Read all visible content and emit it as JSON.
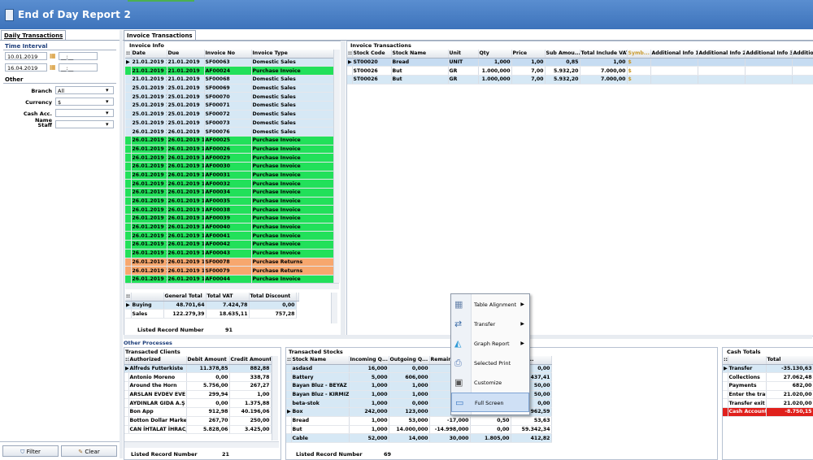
{
  "window": {
    "title": "End of Day Report 2"
  },
  "left_panel": {
    "tab_label": "Daily Transactions",
    "time_interval_label": "Time Interval",
    "date_from": "10.01.2019",
    "date_to": "16.04.2019",
    "time_from": "__:__",
    "time_to": "__:__",
    "other_label": "Other",
    "fields": [
      {
        "label": "Branch",
        "value": "All"
      },
      {
        "label": "Currency",
        "value": "$"
      },
      {
        "label": "Cash Acc. Name",
        "value": ""
      },
      {
        "label": "Staff",
        "value": ""
      }
    ],
    "filter_label": "Filter",
    "clear_label": "Clear"
  },
  "main_tab": "Invoice Transactions",
  "invoice_info": {
    "title": "Invoice Info",
    "columns": [
      "Date",
      "Due",
      "Invoice No",
      "Invoice Type"
    ],
    "rows": [
      {
        "date": "21.01.2019 1",
        "due": "21.01.2019",
        "no": "SF00063",
        "type": "Domestic Sales",
        "color": "#d6e8f5"
      },
      {
        "date": "21.01.2019 1",
        "due": "21.01.2019",
        "no": "AF00024",
        "type": "Purchase Invoice",
        "color": "#22e05a"
      },
      {
        "date": "21.01.2019 1",
        "due": "21.01.2019",
        "no": "SF00068",
        "type": "Domestic Sales",
        "color": "#d6e8f5"
      },
      {
        "date": "25.01.2019 1",
        "due": "25.01.2019",
        "no": "SF00069",
        "type": "Domestic Sales",
        "color": "#d6e8f5"
      },
      {
        "date": "25.01.2019 1",
        "due": "25.01.2019",
        "no": "SF00070",
        "type": "Domestic Sales",
        "color": "#d6e8f5"
      },
      {
        "date": "25.01.2019 1",
        "due": "25.01.2019",
        "no": "SF00071",
        "type": "Domestic Sales",
        "color": "#d6e8f5"
      },
      {
        "date": "25.01.2019 1",
        "due": "25.01.2019",
        "no": "SF00072",
        "type": "Domestic Sales",
        "color": "#d6e8f5"
      },
      {
        "date": "25.01.2019 1",
        "due": "25.01.2019",
        "no": "SF00073",
        "type": "Domestic Sales",
        "color": "#d6e8f5"
      },
      {
        "date": "26.01.2019 1",
        "due": "26.01.2019",
        "no": "SF00076",
        "type": "Domestic Sales",
        "color": "#d6e8f5"
      },
      {
        "date": "26.01.2019 1",
        "due": "26.01.2019 1",
        "no": "AF00025",
        "type": "Purchase Invoice",
        "color": "#22e05a"
      },
      {
        "date": "26.01.2019 1",
        "due": "26.01.2019 1",
        "no": "AF00026",
        "type": "Purchase Invoice",
        "color": "#22e05a"
      },
      {
        "date": "26.01.2019 1",
        "due": "26.01.2019 1",
        "no": "AF00029",
        "type": "Purchase Invoice",
        "color": "#22e05a"
      },
      {
        "date": "26.01.2019 1",
        "due": "26.01.2019 1",
        "no": "AF00030",
        "type": "Purchase Invoice",
        "color": "#22e05a"
      },
      {
        "date": "26.01.2019 1",
        "due": "26.01.2019 1",
        "no": "AF00031",
        "type": "Purchase Invoice",
        "color": "#22e05a"
      },
      {
        "date": "26.01.2019 1",
        "due": "26.01.2019 1",
        "no": "AF00032",
        "type": "Purchase Invoice",
        "color": "#22e05a"
      },
      {
        "date": "26.01.2019 1",
        "due": "26.01.2019 1",
        "no": "AF00034",
        "type": "Purchase Invoice",
        "color": "#22e05a"
      },
      {
        "date": "26.01.2019 1",
        "due": "26.01.2019 1",
        "no": "AF00035",
        "type": "Purchase Invoice",
        "color": "#22e05a"
      },
      {
        "date": "26.01.2019 1",
        "due": "26.01.2019 1",
        "no": "AF00038",
        "type": "Purchase Invoice",
        "color": "#22e05a"
      },
      {
        "date": "26.01.2019 1",
        "due": "26.01.2019 1",
        "no": "AF00039",
        "type": "Purchase Invoice",
        "color": "#22e05a"
      },
      {
        "date": "26.01.2019 1",
        "due": "26.01.2019 1",
        "no": "AF00040",
        "type": "Purchase Invoice",
        "color": "#22e05a"
      },
      {
        "date": "26.01.2019 1",
        "due": "26.01.2019 1",
        "no": "AF00041",
        "type": "Purchase Invoice",
        "color": "#22e05a"
      },
      {
        "date": "26.01.2019 1",
        "due": "26.01.2019 1",
        "no": "AF00042",
        "type": "Purchase Invoice",
        "color": "#22e05a"
      },
      {
        "date": "26.01.2019 1",
        "due": "26.01.2019 1",
        "no": "AF00043",
        "type": "Purchase Invoice",
        "color": "#22e05a"
      },
      {
        "date": "26.01.2019 1",
        "due": "26.01.2019 1",
        "no": "SF00078",
        "type": "Purchase Returns",
        "color": "#f7a76e"
      },
      {
        "date": "26.01.2019 1",
        "due": "26.01.2019 1",
        "no": "SF00079",
        "type": "Purchase Returns",
        "color": "#f7a76e"
      },
      {
        "date": "26.01.2019 1",
        "due": "26.01.2019 1",
        "no": "AF00044",
        "type": "Purchase Invoice",
        "color": "#22e05a"
      }
    ]
  },
  "totals": {
    "columns": [
      "General Total",
      "Total VAT",
      "Total Discount"
    ],
    "rows": [
      {
        "label": "Buying",
        "general": "48.701,64",
        "vat": "7.424,78",
        "discount": "0,00"
      },
      {
        "label": "Sales",
        "general": "122.279,39",
        "vat": "18.635,11",
        "discount": "757,28"
      }
    ],
    "listed_label": "Listed Record Number",
    "listed_value": "91"
  },
  "invoice_transactions": {
    "title": "Invoice Transactions",
    "columns": [
      "Stock Code",
      "Stock Name",
      "Unit",
      "Qty",
      "Price",
      "Sub Amou...",
      "Total Include VAT",
      "Symb...",
      "Additional Info 1",
      "Additional Info 2",
      "Additional Info 3",
      "Additio"
    ],
    "rows": [
      {
        "code": "ST00020",
        "name": "Bread",
        "unit": "UNIT",
        "qty": "1,000",
        "price": "1,00",
        "sub": "0,85",
        "total": "1,00",
        "sym": "$"
      },
      {
        "code": "ST00026",
        "name": "But",
        "unit": "GR",
        "qty": "1.000,000",
        "price": "7,00",
        "sub": "5.932,20",
        "total": "7.000,00",
        "sym": "$"
      },
      {
        "code": "ST00026",
        "name": "But",
        "unit": "GR",
        "qty": "1.000,000",
        "price": "7,00",
        "sub": "5.932,20",
        "total": "7.000,00",
        "sym": "$"
      }
    ]
  },
  "other_processes": {
    "title": "Other Processes"
  },
  "clients": {
    "title": "Transacted Clients",
    "columns": [
      "Authorized",
      "Debit Amount",
      "Credit Amount"
    ],
    "rows": [
      {
        "name": "Alfreds Futterkiste",
        "debit": "11.378,85",
        "credit": "882,88"
      },
      {
        "name": "Antonio Moreno",
        "debit": "0,00",
        "credit": "338,78"
      },
      {
        "name": "Around the Horn",
        "debit": "5.756,00",
        "credit": "267,27"
      },
      {
        "name": "ARSLAN EVDEV EVE T/",
        "debit": "299,94",
        "credit": "1,00"
      },
      {
        "name": "AYDINLAR GIDA A.Ş",
        "debit": "0,00",
        "credit": "1.375,88"
      },
      {
        "name": "Bon App",
        "debit": "912,98",
        "credit": "40.196,06"
      },
      {
        "name": "Botton Dollar Market",
        "debit": "267,70",
        "credit": "250,00"
      },
      {
        "name": "CAN İHTALAT İHRAC/",
        "debit": "5.828,06",
        "credit": "3.425,00"
      }
    ],
    "listed_label": "Listed Record Number",
    "listed_value": "21"
  },
  "stocks": {
    "title": "Transacted Stocks",
    "columns": [
      "Stock Name",
      "Incoming Q...",
      "Outgoing Q...",
      "Remaini...",
      "",
      "Amou..."
    ],
    "rows": [
      {
        "name": "asdasd",
        "in": "16,000",
        "out": "0,000",
        "rem": "16",
        "x": "",
        "amt": "0,00"
      },
      {
        "name": "Battery",
        "in": "5,000",
        "out": "606,000",
        "rem": "-601",
        "x": "",
        "amt": "437,41"
      },
      {
        "name": "Bayan Bluz - BEYAZ -",
        "in": "1,000",
        "out": "1,000",
        "rem": "-3",
        "x": "",
        "amt": "50,00"
      },
      {
        "name": "Bayan Bluz - KIRMIZI",
        "in": "1,000",
        "out": "1,000",
        "rem": "0",
        "x": "",
        "amt": "50,00"
      },
      {
        "name": "beta-stok",
        "in": "1,000",
        "out": "0,000",
        "rem": "1",
        "x": "",
        "amt": "0,00"
      },
      {
        "name": "Box",
        "in": "242,000",
        "out": "123,000",
        "rem": "119",
        "x": "",
        "amt": "962,59"
      },
      {
        "name": "Bread",
        "in": "1,000",
        "out": "53,000",
        "rem": "-17,000",
        "x": "0,50",
        "amt": "53,63"
      },
      {
        "name": "But",
        "in": "1,000",
        "out": "14.000,000",
        "rem": "-14.998,000",
        "x": "0,00",
        "amt": "59.342,34"
      },
      {
        "name": "Cable",
        "in": "52,000",
        "out": "14,000",
        "rem": "30,000",
        "x": "1.805,00",
        "amt": "412,82"
      }
    ],
    "listed_label": "Listed Record Number",
    "listed_value": "69"
  },
  "cash_totals": {
    "title": "Cash Totals",
    "column": "Total",
    "rows": [
      {
        "name": "Transfer",
        "value": "-35.130,63"
      },
      {
        "name": "Collections",
        "value": "27.062,48"
      },
      {
        "name": "Payments",
        "value": "682,00"
      },
      {
        "name": "Enter the tran",
        "value": "21.020,00"
      },
      {
        "name": "Transfer exit",
        "value": "21.020,00"
      },
      {
        "name": "Cash Account",
        "value": "-8.750,15",
        "highlight": "#e0201c"
      }
    ]
  },
  "context_menu": {
    "items": [
      {
        "label": "Table Alignment",
        "submenu": true,
        "icon": "table-icon"
      },
      {
        "label": "Transfer",
        "submenu": true,
        "icon": "transfer-icon"
      },
      {
        "label": "Graph Report",
        "submenu": true,
        "icon": "graph-icon"
      },
      {
        "label": "Selected Print",
        "submenu": false,
        "icon": "print-icon"
      },
      {
        "label": "Customize",
        "submenu": false,
        "icon": "customize-icon"
      },
      {
        "label": "Full Screen",
        "submenu": false,
        "icon": "fullscreen-icon",
        "selected": true
      }
    ]
  }
}
